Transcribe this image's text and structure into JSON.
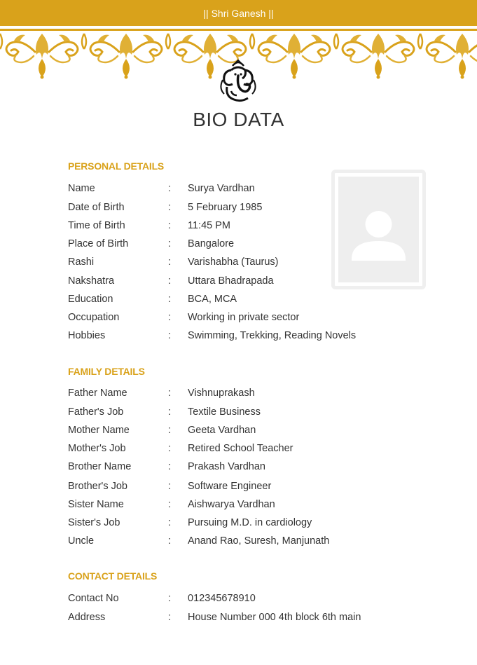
{
  "header": {
    "top_text": "|| Shri Ganesh ||",
    "title": "BIO DATA"
  },
  "colors": {
    "accent": "#d9a21b",
    "text": "#333333",
    "photo_placeholder": "#eeeeee"
  },
  "icons": {
    "ganesh": "ganesh-symbol-icon",
    "photo": "person-placeholder-icon"
  },
  "separator": ":",
  "personal": {
    "heading": "PERSONAL DETAILS",
    "rows": [
      {
        "label": "Name",
        "value": "Surya Vardhan"
      },
      {
        "label": "Date of Birth",
        "value": "5 February 1985"
      },
      {
        "label": "Time of Birth",
        "value": "11:45 PM"
      },
      {
        "label": "Place of Birth",
        "value": "Bangalore"
      },
      {
        "label": "Rashi",
        "value": "Varishabha (Taurus)"
      },
      {
        "label": "Nakshatra",
        "value": "Uttara Bhadrapada"
      },
      {
        "label": "Education",
        "value": "BCA, MCA"
      },
      {
        "label": "Occupation",
        "value": "Working in private sector"
      },
      {
        "label": "Hobbies",
        "value": "Swimming, Trekking, Reading Novels"
      }
    ]
  },
  "family": {
    "heading": "FAMILY DETAILS",
    "rows": [
      {
        "label": "Father Name",
        "value": "Vishnuprakash"
      },
      {
        "label": "Father's Job",
        "value": "Textile Business"
      },
      {
        "label": "Mother Name",
        "value": "Geeta Vardhan"
      },
      {
        "label": "Mother's Job",
        "value": "Retired School Teacher"
      },
      {
        "label": "Brother Name",
        "value": "Prakash Vardhan"
      },
      {
        "label": "Brother's Job",
        "value": "Software Engineer"
      },
      {
        "label": "Sister Name",
        "value": "Aishwarya Vardhan"
      },
      {
        "label": "Sister's Job",
        "value": "Pursuing M.D. in cardiology"
      },
      {
        "label": "Uncle",
        "value": "Anand Rao, Suresh, Manjunath"
      }
    ]
  },
  "contact": {
    "heading": "CONTACT DETAILS",
    "rows": [
      {
        "label": "Contact No",
        "value": "012345678910"
      },
      {
        "label": "Address",
        "value": "House Number 000 4th block 6th main"
      }
    ]
  }
}
